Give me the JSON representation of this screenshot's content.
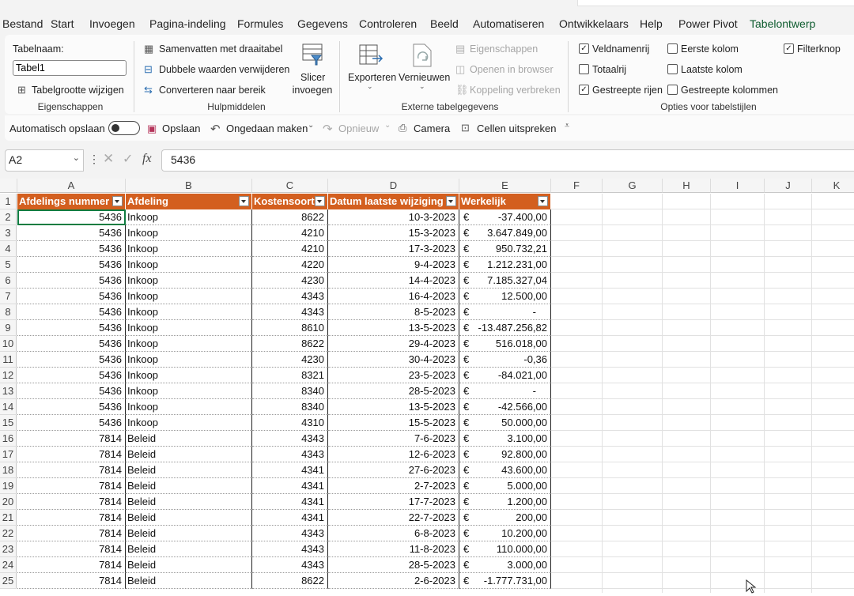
{
  "tabs": [
    "Bestand",
    "Start",
    "Invoegen",
    "Pagina-indeling",
    "Formules",
    "Gegevens",
    "Controleren",
    "Beeld",
    "Automatiseren",
    "Ontwikkelaars",
    "Help",
    "Power Pivot",
    "Tabelontwerp"
  ],
  "ribbon": {
    "eigenschappen": {
      "table_name_label": "Tabelnaam:",
      "table_name_value": "Tabel1",
      "resize_label": "Tabelgrootte wijzigen",
      "group_label": "Eigenschappen"
    },
    "hulpmiddelen": {
      "pivot_label": "Samenvatten met draaitabel",
      "dedupe_label": "Dubbele waarden verwijderen",
      "convert_label": "Converteren naar bereik",
      "slicer_line1": "Slicer",
      "slicer_line2": "invoegen",
      "group_label": "Hulpmiddelen"
    },
    "extern": {
      "export_label": "Exporteren",
      "refresh_label": "Vernieuwen",
      "properties_label": "Eigenschappen",
      "open_browser_label": "Openen in browser",
      "unlink_label": "Koppeling verbreken",
      "group_label": "Externe tabelgegevens"
    },
    "stijlopties": {
      "header_row": "Veldnamenrij",
      "total_row": "Totaalrij",
      "banded_rows": "Gestreepte rijen",
      "first_col": "Eerste kolom",
      "last_col": "Laatste kolom",
      "banded_cols": "Gestreepte kolommen",
      "filter_btn": "Filterknop",
      "group_label": "Opties voor tabelstijlen",
      "checks": {
        "header_row": "✓",
        "total_row": "",
        "banded_rows": "✓",
        "first_col": "",
        "last_col": "",
        "banded_cols": "",
        "filter_btn": "✓"
      }
    }
  },
  "qat": {
    "autosave_label": "Automatisch opslaan",
    "save_label": "Opslaan",
    "undo_label": "Ongedaan maken",
    "redo_label": "Opnieuw",
    "camera_label": "Camera",
    "speak_label": "Cellen uitspreken"
  },
  "formula": {
    "name_box": "A2",
    "fx": "fx",
    "value": "5436"
  },
  "columns": [
    "A",
    "B",
    "C",
    "D",
    "E",
    "F",
    "G",
    "H",
    "I",
    "J",
    "K"
  ],
  "table_headers": [
    "Afdelings nummer",
    "Afdeling",
    "Kostensoort",
    "Datum laatste wijziging",
    "Werkelijk"
  ],
  "row_numbers": [
    "1",
    "2",
    "3",
    "4",
    "5",
    "6",
    "7",
    "8",
    "9",
    "10",
    "11",
    "12",
    "13",
    "14",
    "15",
    "16",
    "17",
    "18",
    "19",
    "20",
    "21",
    "22",
    "23",
    "24",
    "25"
  ],
  "rows": [
    [
      "5436",
      "Inkoop",
      "8622",
      "10-3-2023",
      "€",
      "-37.400,00"
    ],
    [
      "5436",
      "Inkoop",
      "4210",
      "15-3-2023",
      "€",
      "3.647.849,00"
    ],
    [
      "5436",
      "Inkoop",
      "4210",
      "17-3-2023",
      "€",
      "950.732,21"
    ],
    [
      "5436",
      "Inkoop",
      "4220",
      "9-4-2023",
      "€",
      "1.212.231,00"
    ],
    [
      "5436",
      "Inkoop",
      "4230",
      "14-4-2023",
      "€",
      "7.185.327,04"
    ],
    [
      "5436",
      "Inkoop",
      "4343",
      "16-4-2023",
      "€",
      "12.500,00"
    ],
    [
      "5436",
      "Inkoop",
      "4343",
      "8-5-2023",
      "€",
      "-"
    ],
    [
      "5436",
      "Inkoop",
      "8610",
      "13-5-2023",
      "€",
      "-13.487.256,82"
    ],
    [
      "5436",
      "Inkoop",
      "8622",
      "29-4-2023",
      "€",
      "516.018,00"
    ],
    [
      "5436",
      "Inkoop",
      "4230",
      "30-4-2023",
      "€",
      "-0,36"
    ],
    [
      "5436",
      "Inkoop",
      "8321",
      "23-5-2023",
      "€",
      "-84.021,00"
    ],
    [
      "5436",
      "Inkoop",
      "8340",
      "28-5-2023",
      "€",
      "-"
    ],
    [
      "5436",
      "Inkoop",
      "8340",
      "13-5-2023",
      "€",
      "-42.566,00"
    ],
    [
      "5436",
      "Inkoop",
      "4310",
      "15-5-2023",
      "€",
      "50.000,00"
    ],
    [
      "7814",
      "Beleid",
      "4343",
      "7-6-2023",
      "€",
      "3.100,00"
    ],
    [
      "7814",
      "Beleid",
      "4343",
      "12-6-2023",
      "€",
      "92.800,00"
    ],
    [
      "7814",
      "Beleid",
      "4341",
      "27-6-2023",
      "€",
      "43.600,00"
    ],
    [
      "7814",
      "Beleid",
      "4341",
      "2-7-2023",
      "€",
      "5.000,00"
    ],
    [
      "7814",
      "Beleid",
      "4341",
      "17-7-2023",
      "€",
      "1.200,00"
    ],
    [
      "7814",
      "Beleid",
      "4341",
      "22-7-2023",
      "€",
      "200,00"
    ],
    [
      "7814",
      "Beleid",
      "4343",
      "6-8-2023",
      "€",
      "10.200,00"
    ],
    [
      "7814",
      "Beleid",
      "4343",
      "11-8-2023",
      "€",
      "110.000,00"
    ],
    [
      "7814",
      "Beleid",
      "4343",
      "28-5-2023",
      "€",
      "3.000,00"
    ],
    [
      "7814",
      "Beleid",
      "8622",
      "2-6-2023",
      "€",
      "-1.777.731,00"
    ]
  ],
  "colors": {
    "table_header": "#d35f1f",
    "active_tab": "#0e7a3e"
  }
}
